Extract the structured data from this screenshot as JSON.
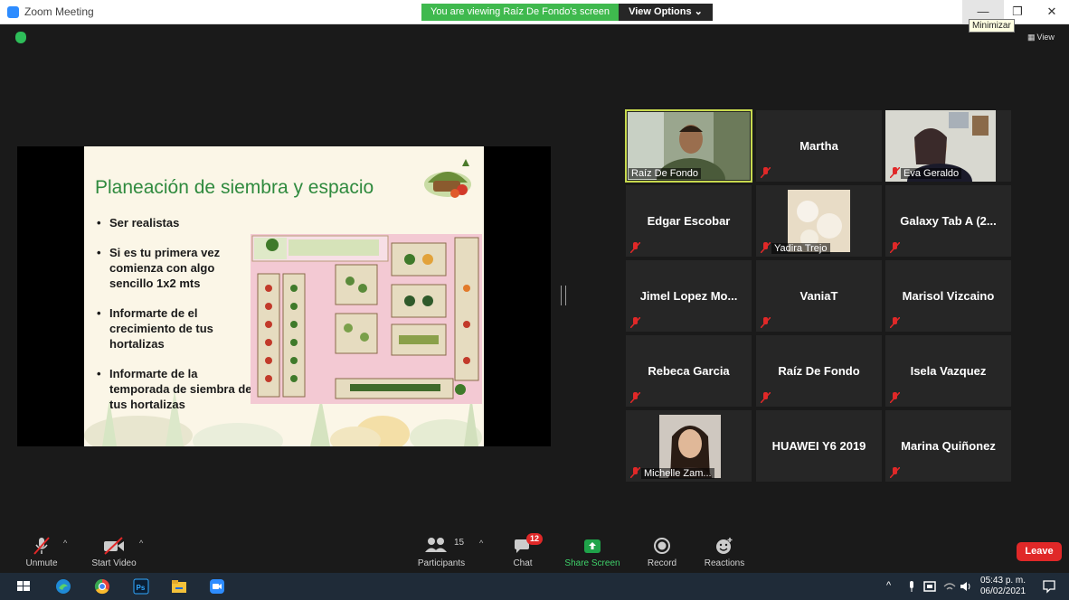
{
  "window": {
    "title": "Zoom Meeting",
    "share_banner": "You are viewing Raíz De Fondo's screen",
    "view_options": "View Options",
    "minimize_tooltip": "Minimizar",
    "view_label": "View"
  },
  "slide": {
    "title": "Planeación de siembra y espacio",
    "bullets": [
      "Ser realistas",
      "Si es tu primera vez comienza con algo sencillo 1x2 mts",
      "Informarte de el crecimiento de tus hortalizas",
      "Informarte de la temporada de siembra de tus hortalizas"
    ]
  },
  "participants": [
    {
      "name": "Raíz De Fondo",
      "type": "video",
      "active": true
    },
    {
      "name": "Martha",
      "type": "text"
    },
    {
      "name": "Eva Geraldo",
      "type": "video"
    },
    {
      "name": "Edgar Escobar",
      "type": "text"
    },
    {
      "name": "Yadira Trejo",
      "type": "photo"
    },
    {
      "name": "Galaxy Tab A (2...",
      "type": "text"
    },
    {
      "name": "Jimel Lopez Mo...",
      "type": "text"
    },
    {
      "name": "VaniaT",
      "type": "text"
    },
    {
      "name": "Marisol Vizcaino",
      "type": "text"
    },
    {
      "name": "Rebeca Garcia",
      "type": "text"
    },
    {
      "name": "Raíz De Fondo",
      "type": "text"
    },
    {
      "name": "Isela Vazquez",
      "type": "text"
    },
    {
      "name": "Michelle Zam...",
      "type": "photo"
    },
    {
      "name": "HUAWEI Y6 2019",
      "type": "text"
    },
    {
      "name": "Marina Quiñonez",
      "type": "text"
    }
  ],
  "toolbar": {
    "unmute": "Unmute",
    "start_video": "Start Video",
    "participants": "Participants",
    "participants_count": "15",
    "chat": "Chat",
    "chat_badge": "12",
    "share_screen": "Share Screen",
    "record": "Record",
    "reactions": "Reactions",
    "leave": "Leave"
  },
  "taskbar": {
    "time": "05:43 p. m.",
    "date": "06/02/2021"
  },
  "colors": {
    "share_banner": "#3fb94e",
    "leave": "#e02828",
    "share_screen": "#1fa34a",
    "active_speaker": "#c7d94e",
    "muted_icon": "#e02828"
  }
}
